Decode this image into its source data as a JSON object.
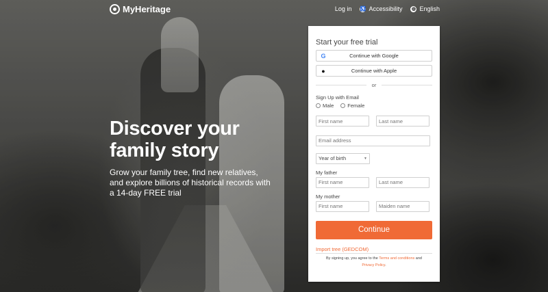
{
  "brand": {
    "name": "MyHeritage"
  },
  "nav": {
    "login": "Log in",
    "accessibility": "Accessibility",
    "language": "English"
  },
  "hero": {
    "title_line1": "Discover your",
    "title_line2": "family story",
    "subtitle_line1": "Grow your family tree, find new relatives,",
    "subtitle_line2": "and explore billions of historical records with",
    "subtitle_line3": "a 14-day FREE trial"
  },
  "signup": {
    "title": "Start your free trial",
    "google_label": "Continue with Google",
    "apple_label": "Continue with Apple",
    "or": "or",
    "email_signup_label": "Sign Up with Email",
    "gender": {
      "male": "Male",
      "female": "Female"
    },
    "first_name_placeholder": "First name",
    "last_name_placeholder": "Last name",
    "email_placeholder": "Email address",
    "year_of_birth": "Year of birth",
    "father_label": "My father",
    "father_first_placeholder": "First name",
    "father_last_placeholder": "Last name",
    "mother_label": "My mother",
    "mother_first_placeholder": "First name",
    "mother_maiden_placeholder": "Maiden name",
    "continue_label": "Continue",
    "import_label": "Import tree (GEDCOM)",
    "terms_prefix": "By signing up, you agree to the ",
    "terms_link": "Terms and conditions",
    "terms_and": " and",
    "privacy_link": "Privacy Policy",
    "terms_suffix": "."
  },
  "colors": {
    "accent": "#f06a36",
    "card_bg": "#ffffff",
    "text": "#444444"
  },
  "icons": {
    "logo": "myheritage-logo-icon",
    "accessibility": "accessibility-icon",
    "language": "globe-icon",
    "google": "google-icon",
    "apple": "apple-icon"
  }
}
